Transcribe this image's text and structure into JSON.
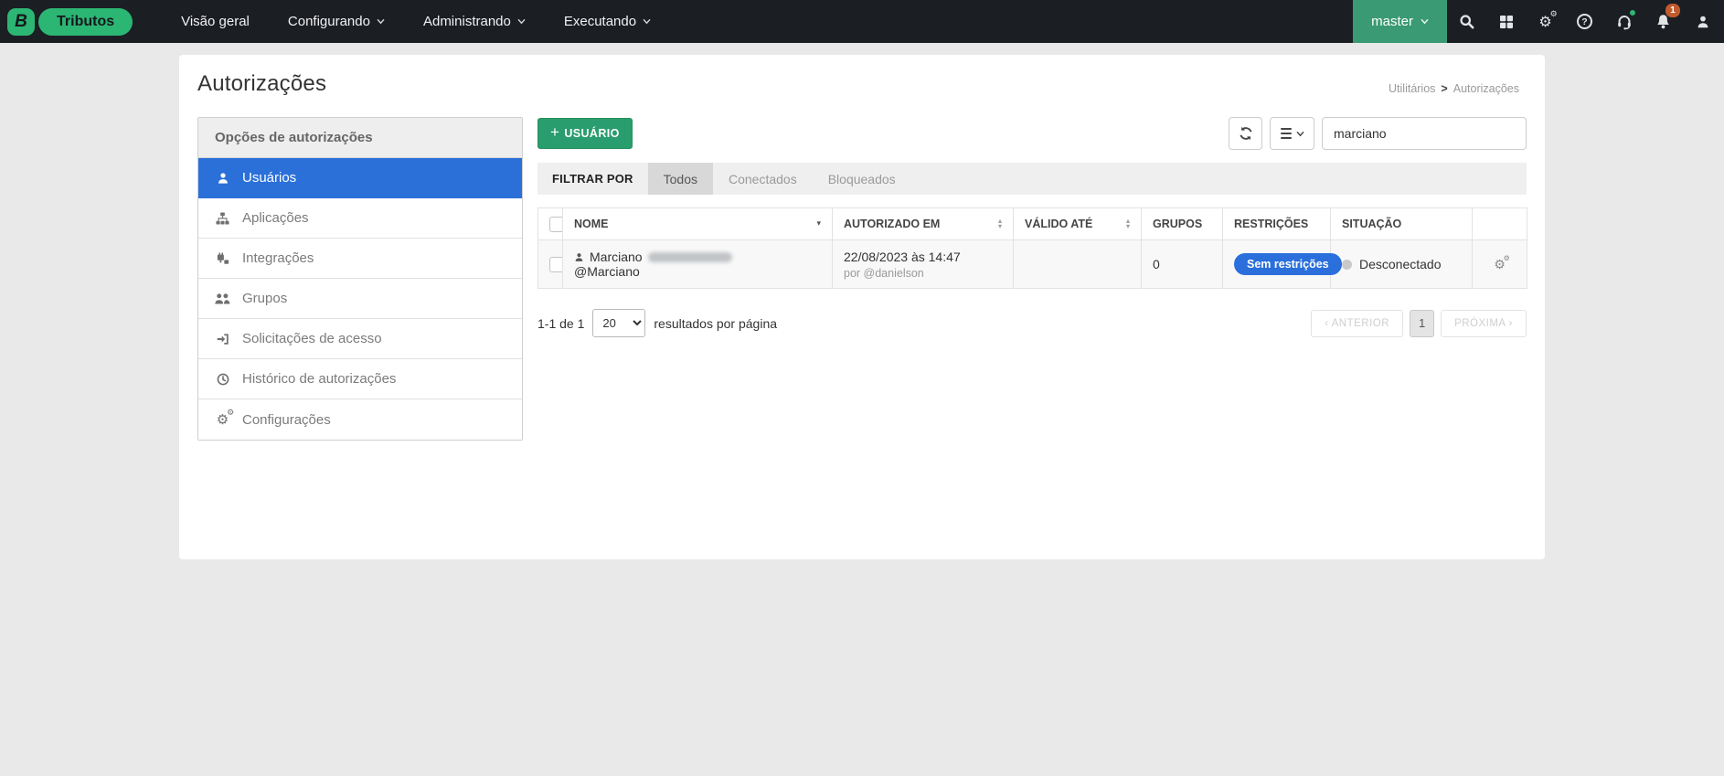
{
  "navbar": {
    "logo_badge": "B",
    "product": "Tributos",
    "menu": [
      {
        "label": "Visão geral",
        "has_caret": false
      },
      {
        "label": "Configurando",
        "has_caret": true
      },
      {
        "label": "Administrando",
        "has_caret": true
      },
      {
        "label": "Executando",
        "has_caret": true
      }
    ],
    "master_label": "master",
    "notification_count": "1"
  },
  "page": {
    "title": "Autorizações",
    "breadcrumb": {
      "parent": "Utilitários",
      "separator": ">",
      "current": "Autorizações"
    }
  },
  "sidebar": {
    "header": "Opções de autorizações",
    "items": [
      {
        "label": "Usuários",
        "icon": "user-icon",
        "active": true
      },
      {
        "label": "Aplicações",
        "icon": "sitemap-icon",
        "active": false
      },
      {
        "label": "Integrações",
        "icon": "integration-icon",
        "active": false
      },
      {
        "label": "Grupos",
        "icon": "users-group-icon",
        "active": false
      },
      {
        "label": "Solicitações de acesso",
        "icon": "sign-in-icon",
        "active": false
      },
      {
        "label": "Histórico de autorizações",
        "icon": "history-clock-icon",
        "active": false
      },
      {
        "label": "Configurações",
        "icon": "gears-icon",
        "active": false
      }
    ]
  },
  "toolbar": {
    "add_user_plus": "+",
    "add_user_label": "USUÁRIO",
    "search_value": "marciano"
  },
  "filter": {
    "label": "FILTRAR POR",
    "tabs": [
      {
        "label": "Todos",
        "active": true
      },
      {
        "label": "Conectados",
        "active": false
      },
      {
        "label": "Bloqueados",
        "active": false
      }
    ]
  },
  "table": {
    "columns": [
      {
        "label": "NOME",
        "sort": "desc"
      },
      {
        "label": "AUTORIZADO EM",
        "sort": "both"
      },
      {
        "label": "VÁLIDO ATÉ",
        "sort": "both"
      },
      {
        "label": "GRUPOS",
        "sort": "none"
      },
      {
        "label": "RESTRIÇÕES",
        "sort": "none"
      },
      {
        "label": "SITUAÇÃO",
        "sort": "none"
      }
    ],
    "row": {
      "name": "Marciano",
      "handle": "@Marciano",
      "authorized_at": "22/08/2023 às 14:47",
      "authorized_by": "por @danielson",
      "valid_until": "",
      "groups": "0",
      "restrictions_badge": "Sem restrições",
      "status": "Desconectado"
    }
  },
  "pagination": {
    "summary": "1-1 de 1",
    "page_size": "20",
    "per_page_label": "resultados por página",
    "prev_label": "‹ ANTERIOR",
    "current_page": "1",
    "next_label": "PRÓXIMA ›"
  },
  "colors": {
    "navbar_bg": "#1b1e23",
    "brand_green": "#2cb673",
    "master_green": "#3a9a73",
    "active_blue": "#2a70d8",
    "badge_blue": "#2a6fdb",
    "add_button_green": "#2a9d6e",
    "notification_badge": "#c05b2e",
    "status_dot_gray": "#c9c9c9"
  }
}
